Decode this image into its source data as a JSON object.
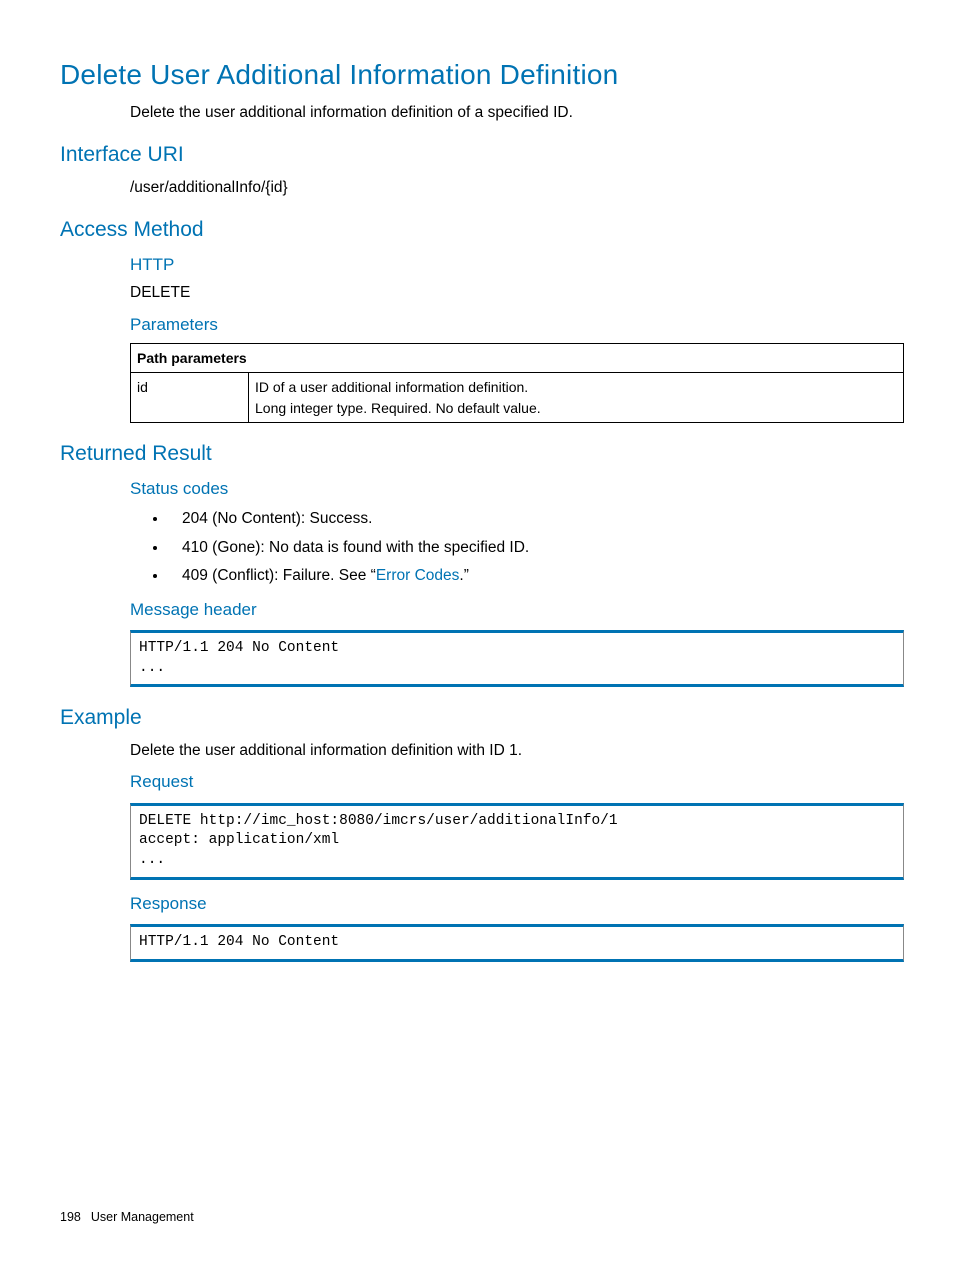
{
  "title": "Delete User Additional Information Definition",
  "intro": "Delete the user additional information definition of a specified ID.",
  "sections": {
    "interface_uri": {
      "heading": "Interface URI",
      "value": "/user/additionalInfo/{id}"
    },
    "access_method": {
      "heading": "Access Method",
      "http_label": "HTTP",
      "http_value": "DELETE",
      "parameters_label": "Parameters",
      "table": {
        "header": "Path parameters",
        "row": {
          "name": "id",
          "desc1": "ID of a user additional information definition.",
          "desc2": "Long integer type. Required. No default value."
        }
      }
    },
    "returned_result": {
      "heading": "Returned Result",
      "status_codes_label": "Status codes",
      "status_items": [
        "204 (No Content): Success.",
        "410 (Gone): No data is found with the specified ID.",
        "409 (Conflict): Failure. See “"
      ],
      "error_codes_link": "Error Codes",
      "after_link": ".”",
      "message_header_label": "Message header",
      "message_header_code": "HTTP/1.1 204 No Content\n..."
    },
    "example": {
      "heading": "Example",
      "intro": "Delete the user additional information definition with ID 1.",
      "request_label": "Request",
      "request_code": "DELETE http://imc_host:8080/imcrs/user/additionalInfo/1\naccept: application/xml\n...",
      "response_label": "Response",
      "response_code": "HTTP/1.1 204 No Content"
    }
  },
  "footer": {
    "page": "198",
    "section": "User Management"
  }
}
